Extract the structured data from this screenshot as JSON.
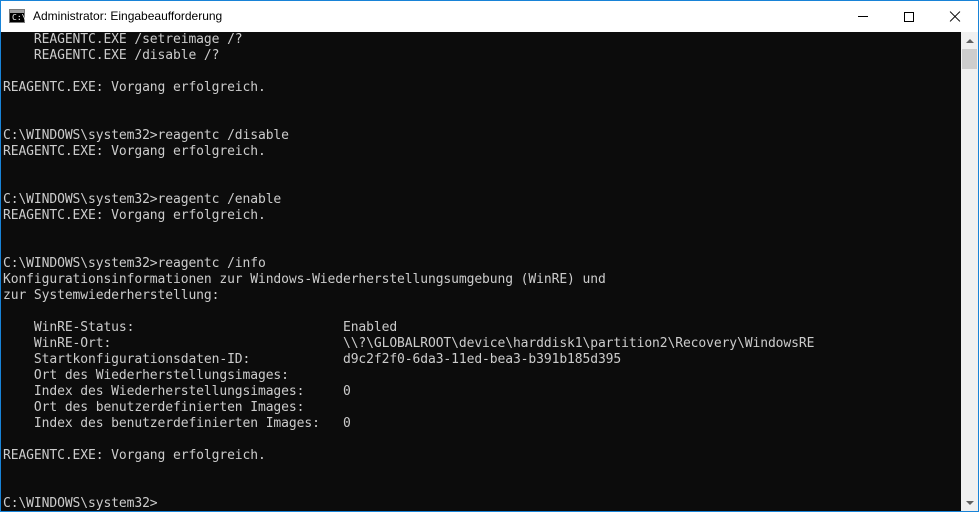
{
  "window": {
    "title": "Administrator: Eingabeaufforderung",
    "icon_glyph": "C:\\_",
    "icon": "cmd-icon",
    "controls": [
      "minimize-icon",
      "maximize-icon",
      "close-icon"
    ]
  },
  "console": {
    "lines": [
      "    REAGENTC.EXE /setreimage /?",
      "    REAGENTC.EXE /disable /?",
      "",
      "REAGENTC.EXE: Vorgang erfolgreich.",
      "",
      "",
      "C:\\WINDOWS\\system32>reagentc /disable",
      "REAGENTC.EXE: Vorgang erfolgreich.",
      "",
      "",
      "C:\\WINDOWS\\system32>reagentc /enable",
      "REAGENTC.EXE: Vorgang erfolgreich.",
      "",
      "",
      "C:\\WINDOWS\\system32>reagentc /info",
      "Konfigurationsinformationen zur Windows-Wiederherstellungsumgebung (WinRE) und",
      "zur Systemwiederherstellung:",
      "",
      "    WinRE-Status:                           Enabled",
      "    WinRE-Ort:                              \\\\?\\GLOBALROOT\\device\\harddisk1\\partition2\\Recovery\\WindowsRE",
      "    Startkonfigurationsdaten-ID:            d9c2f2f0-6da3-11ed-bea3-b391b185d395",
      "    Ort des Wiederherstellungsimages:",
      "    Index des Wiederherstellungsimages:     0",
      "    Ort des benutzerdefinierten Images:",
      "    Index des benutzerdefinierten Images:   0",
      "",
      "REAGENTC.EXE: Vorgang erfolgreich.",
      "",
      "",
      "C:\\WINDOWS\\system32>"
    ]
  },
  "colors": {
    "background": "#0c0c0c",
    "text": "#cccccc",
    "titlebar": "#ffffff",
    "border": "#1883d7"
  }
}
